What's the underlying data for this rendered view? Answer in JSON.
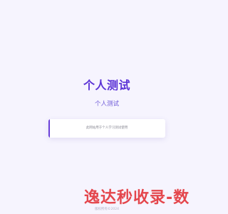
{
  "header": {
    "title": "个人测试",
    "subtitle": "个人测试"
  },
  "card": {
    "description": "此网站用于个人学习测试使用"
  },
  "watermark": {
    "text": "逸达秒收录-数"
  },
  "footer": {
    "text": "版权所有©2024"
  },
  "colors": {
    "background": "#f6f4fe",
    "title": "#5b33d6",
    "subtitle": "#6f5bd8",
    "accent": "#6a3fd9",
    "watermark": "#e43d43"
  }
}
